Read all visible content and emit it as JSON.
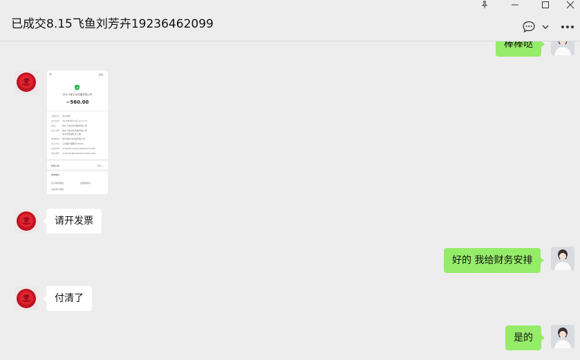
{
  "window": {
    "title": "已成交8.15飞鱼刘芳卉19236462099"
  },
  "toolbar": {
    "icons": [
      "pin-icon",
      "minimize-icon",
      "maximize-icon",
      "close-icon",
      "chat-bubble-icon",
      "chevron-down-icon",
      "more-icon"
    ]
  },
  "messages": [
    {
      "side": "right",
      "text": "棒棒哒"
    },
    {
      "side": "left",
      "type": "image",
      "text": ""
    },
    {
      "side": "left",
      "text": "请开发票"
    },
    {
      "side": "right",
      "text": "好的 我给财务安排"
    },
    {
      "side": "left",
      "text": "付清了"
    },
    {
      "side": "right",
      "text": "是的"
    }
  ],
  "receipt": {
    "top_left": "×",
    "top_right": "投诉 ···",
    "merchant": "杭州飞鱼文化传播有限公司",
    "amount": "−560.00",
    "rows": [
      {
        "k": "当前状态",
        "v": "支付成功"
      },
      {
        "k": "支付时间",
        "v": "2024年8月15日 16:37:11"
      },
      {
        "k": "商品",
        "v": "杭州飞鱼文化传播有限公司"
      },
      {
        "k": "商户全称",
        "v": "杭州飞鱼文化传播有限公司"
      },
      {
        "k": "",
        "v": "杭州市西湖区文三路"
      },
      {
        "k": "收单机构",
        "v": "财付通支付科技有限公司"
      },
      {
        "k": "支付方式",
        "v": "工商银行储蓄卡(9626)"
      },
      {
        "k": "交易单号",
        "v": "4200002322202408155270781"
      },
      {
        "k": "商户单号",
        "v": "1FTJ8S9F8S0D8S9F0a5D8b7Bb4"
      }
    ],
    "link1_left": "账单分类",
    "link1_right": "转账 >",
    "section": "账单服务",
    "service1": "对订单有疑惑",
    "service2": "发起群收款",
    "service3": "在此商户消费"
  }
}
